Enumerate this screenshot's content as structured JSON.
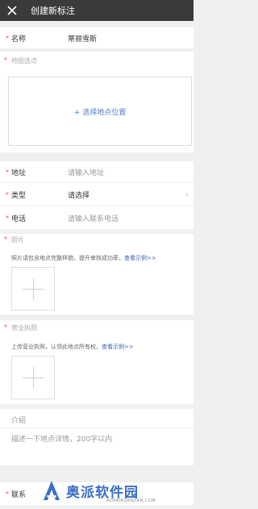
{
  "header": {
    "title": "创建新标注",
    "close_icon": "close-icon"
  },
  "fields": {
    "name": {
      "label": "名称",
      "value": "蒂丽雪斯"
    },
    "map": {
      "label": "地图选点",
      "action": "+ 选择地点位置"
    },
    "address": {
      "label": "地址",
      "placeholder": "请输入地址"
    },
    "type": {
      "label": "类型",
      "value": "请选择"
    },
    "phone": {
      "label": "电话",
      "placeholder": "请输入联系电话"
    },
    "photo": {
      "label": "照片",
      "hint": "照片请包含地点完整样貌，提升审核成功率，",
      "link": "查看示例>>"
    },
    "license": {
      "label": "营业执照",
      "hint": "上传营业执照，认领此地点所有权，",
      "link": "查看示例>>"
    },
    "intro": {
      "label": "介绍",
      "placeholder": "描述一下地点详情，200字以内"
    },
    "contact": {
      "label": "联系"
    }
  },
  "required_mark": "*",
  "watermark": {
    "text": "奥派软件园",
    "url": "AOPAIRUANJIAN.COM"
  },
  "colors": {
    "topbar": "#3a3a3a",
    "accent": "#4a7fd6",
    "required": "#e05a5a"
  }
}
